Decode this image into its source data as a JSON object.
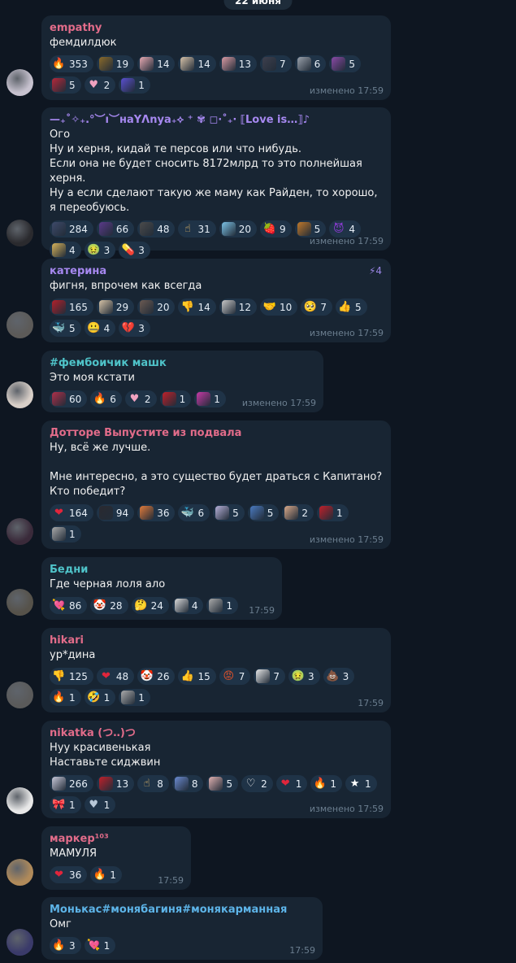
{
  "date_pill": "22 июня",
  "messages": [
    {
      "name": "empathy",
      "name_color": "#e26c8a",
      "lines": [
        "фемдилдюк"
      ],
      "time": "изменено 17:59",
      "avatar_color": "#c7c2cf",
      "reactions": [
        {
          "icon": "fire",
          "count": "353",
          "color": "#f28a24"
        },
        {
          "icon": "custom-emoji",
          "count": "19",
          "color": "#8a6a2a"
        },
        {
          "icon": "custom-emoji",
          "count": "14",
          "color": "#e7a9b2"
        },
        {
          "icon": "custom-emoji",
          "count": "14",
          "color": "#d6c2a8"
        },
        {
          "icon": "custom-emoji",
          "count": "13",
          "color": "#d99aa3"
        },
        {
          "icon": "custom-emoji",
          "count": "7",
          "color": "#3d3f4d"
        },
        {
          "icon": "custom-emoji",
          "count": "6",
          "color": "#9aa1ab"
        },
        {
          "icon": "custom-emoji",
          "count": "5",
          "color": "#8a4aa6"
        },
        {
          "icon": "custom-emoji",
          "count": "5",
          "color": "#b7283a"
        },
        {
          "icon": "heart-pink",
          "count": "2",
          "color": "#f0a2c0"
        },
        {
          "icon": "custom-emoji",
          "count": "1",
          "color": "#5a4fd0"
        }
      ]
    },
    {
      "name": "—₊˚✧₊.°︶ı︶нaYᐱnya₊⟡ ⁺ ✾  ◻︎⋅˚₊‧ ⟦Love is…⟧♪",
      "name_color": "#a688f0",
      "lines": [
        "Ого",
        "Ну и херня, кидай те персов или что нибудь.",
        "Если она не будет сносить 8172млрд то это полнейшая херня.",
        "Ну а если сделают такую же маму как Райден, то хорошо, я переобуюсь."
      ],
      "time": "изменено 17:59",
      "avatar_color": "#2a2a2e",
      "reactions": [
        {
          "icon": "custom-emoji",
          "count": "284",
          "color": "#3e4a6a"
        },
        {
          "icon": "custom-emoji",
          "count": "66",
          "color": "#5a3a8a"
        },
        {
          "icon": "custom-emoji",
          "count": "48",
          "color": "#4b4b4b"
        },
        {
          "icon": "finger",
          "count": "31",
          "color": "#f3c36b"
        },
        {
          "icon": "custom-emoji",
          "count": "20",
          "color": "#7bc2e6"
        },
        {
          "icon": "strawberry",
          "count": "9",
          "color": "#d93a3a"
        },
        {
          "icon": "custom-emoji",
          "count": "5",
          "color": "#c0792a"
        },
        {
          "icon": "devil",
          "count": "4",
          "color": "#8a3bd1"
        },
        {
          "icon": "custom-emoji",
          "count": "4",
          "color": "#d7b35a"
        },
        {
          "icon": "nauseated",
          "count": "3",
          "color": "#7fc042"
        },
        {
          "icon": "pill",
          "count": "3",
          "color": "#e84646"
        }
      ]
    },
    {
      "name": "катерина",
      "name_color": "#a688f0",
      "boost": "4",
      "lines": [
        "фигня, впрочем как всегда"
      ],
      "time": "изменено 17:59",
      "avatar_color": "#5c5a58",
      "reactions": [
        {
          "icon": "custom-emoji",
          "count": "165",
          "color": "#b3202a"
        },
        {
          "icon": "custom-emoji",
          "count": "29",
          "color": "#d6c3a6"
        },
        {
          "icon": "custom-emoji",
          "count": "20",
          "color": "#6b5a52"
        },
        {
          "icon": "thumbs-down",
          "count": "14",
          "color": "#f1b13b"
        },
        {
          "icon": "custom-emoji",
          "count": "12",
          "color": "#c7c7c7"
        },
        {
          "icon": "handshake",
          "count": "10",
          "color": "#f3c36b"
        },
        {
          "icon": "pleading",
          "count": "7",
          "color": "#f3c36b"
        },
        {
          "icon": "thumbs-up",
          "count": "5",
          "color": "#f3c36b"
        },
        {
          "icon": "whale",
          "count": "5",
          "color": "#3fa3e0"
        },
        {
          "icon": "zipper",
          "count": "4",
          "color": "#f3c36b"
        },
        {
          "icon": "broken-heart",
          "count": "3",
          "color": "#e0253b"
        }
      ]
    },
    {
      "name": "#фембоичик машк",
      "name_color": "#4fc3c9",
      "lines": [
        "Это моя кстати"
      ],
      "time": "изменено 17:59",
      "avatar_color": "#d8cfc8",
      "reactions": [
        {
          "icon": "custom-emoji",
          "count": "60",
          "color": "#b0304a"
        },
        {
          "icon": "fire",
          "count": "6",
          "color": "#f28a24"
        },
        {
          "icon": "heart-pink",
          "count": "2",
          "color": "#f0a2c0"
        },
        {
          "icon": "custom-emoji",
          "count": "1",
          "color": "#c0202a"
        },
        {
          "icon": "custom-emoji",
          "count": "1",
          "color": "#c73aa6"
        }
      ]
    },
    {
      "name": "Дотторе Выпустите из подвала",
      "name_color": "#e26c8a",
      "lines": [
        "Ну, всё же лучше.",
        "",
        "Мне интересно, а это существо будет драться с Капитано? Кто победит?"
      ],
      "time": "изменено 17:59",
      "avatar_color": "#3a2a3a",
      "reactions": [
        {
          "icon": "heart-red",
          "count": "164",
          "color": "#e0253b"
        },
        {
          "icon": "custom-emoji",
          "count": "94",
          "color": "#2a2a30"
        },
        {
          "icon": "custom-emoji",
          "count": "36",
          "color": "#e07a3a"
        },
        {
          "icon": "whale",
          "count": "6",
          "color": "#3fa3e0"
        },
        {
          "icon": "custom-emoji",
          "count": "5",
          "color": "#b6b0d8"
        },
        {
          "icon": "custom-emoji",
          "count": "5",
          "color": "#4a7ac0"
        },
        {
          "icon": "custom-emoji",
          "count": "2",
          "color": "#d9a98a"
        },
        {
          "icon": "custom-emoji",
          "count": "1",
          "color": "#c0202a"
        },
        {
          "icon": "custom-emoji",
          "count": "1",
          "color": "#aaaaaa"
        }
      ]
    },
    {
      "name": "Бедни",
      "name_color": "#4fc3c9",
      "lines": [
        "Где черная лоля ало"
      ],
      "time": "17:59",
      "avatar_color": "#56524a",
      "reactions": [
        {
          "icon": "heart-arrow",
          "count": "86",
          "color": "#f04a8a"
        },
        {
          "icon": "clown",
          "count": "28",
          "color": "#f3c36b"
        },
        {
          "icon": "thinking",
          "count": "24",
          "color": "#f3c36b"
        },
        {
          "icon": "custom-emoji",
          "count": "4",
          "color": "#d8d8d8"
        },
        {
          "icon": "custom-emoji",
          "count": "1",
          "color": "#aaaaaa"
        }
      ]
    },
    {
      "name": "hikari",
      "name_color": "#e26c8a",
      "lines": [
        "ур*дина"
      ],
      "time": "17:59",
      "avatar_color": "#5a5a5a",
      "reactions": [
        {
          "icon": "thumbs-down",
          "count": "125",
          "color": "#f1b13b"
        },
        {
          "icon": "heart-red",
          "count": "48",
          "color": "#e0253b"
        },
        {
          "icon": "clown",
          "count": "26",
          "color": "#f3c36b"
        },
        {
          "icon": "thumbs-up",
          "count": "15",
          "color": "#f3c36b"
        },
        {
          "icon": "angry",
          "count": "7",
          "color": "#e2522a"
        },
        {
          "icon": "custom-emoji",
          "count": "7",
          "color": "#e6e6e6"
        },
        {
          "icon": "nauseated",
          "count": "3",
          "color": "#7fc042"
        },
        {
          "icon": "poop",
          "count": "3",
          "color": "#9a5a2a"
        },
        {
          "icon": "fire",
          "count": "1",
          "color": "#f28a24"
        },
        {
          "icon": "rofl",
          "count": "1",
          "color": "#f3c36b"
        },
        {
          "icon": "custom-emoji",
          "count": "1",
          "color": "#aaaaaa"
        }
      ]
    },
    {
      "name": "nikatka (つ‥)つ",
      "name_color": "#e26c8a",
      "lines": [
        "Нуу красивенькая",
        "Наставьте сиджвин"
      ],
      "time": "изменено 17:59",
      "avatar_color": "#e8e8e8",
      "reactions": [
        {
          "icon": "custom-emoji",
          "count": "266",
          "color": "#c9c9d9"
        },
        {
          "icon": "custom-emoji",
          "count": "13",
          "color": "#c0202a"
        },
        {
          "icon": "finger",
          "count": "8",
          "color": "#f3c36b"
        },
        {
          "icon": "custom-emoji",
          "count": "8",
          "color": "#6b8ad0"
        },
        {
          "icon": "custom-emoji",
          "count": "5",
          "color": "#e0b0b0"
        },
        {
          "icon": "heart-white",
          "count": "2",
          "color": "#f2f2f2"
        },
        {
          "icon": "heart-red",
          "count": "1",
          "color": "#e0253b"
        },
        {
          "icon": "fire",
          "count": "1",
          "color": "#f28a24"
        },
        {
          "icon": "star",
          "count": "1",
          "color": "#ffffff"
        },
        {
          "icon": "ribbon",
          "count": "1",
          "color": "#f0c8d0"
        },
        {
          "icon": "heart-silver",
          "count": "1",
          "color": "#b8c8d8"
        }
      ]
    },
    {
      "name": "маркер¹⁰³",
      "name_color": "#e26c8a",
      "lines": [
        "МАМУЛЯ"
      ],
      "time": "17:59",
      "avatar_color": "#b08a5a",
      "reactions": [
        {
          "icon": "heart-red",
          "count": "36",
          "color": "#e0253b"
        },
        {
          "icon": "fire",
          "count": "1",
          "color": "#f28a24"
        }
      ]
    },
    {
      "name": "Монькас#монябагиня#монякарманная",
      "name_color": "#5db4e8",
      "lines": [
        "Омг"
      ],
      "time": "17:59",
      "avatar_color": "#3a3a6a",
      "reactions": [
        {
          "icon": "fire",
          "count": "3",
          "color": "#f28a24"
        },
        {
          "icon": "heart-arrow",
          "count": "1",
          "color": "#f04a8a"
        }
      ]
    }
  ]
}
